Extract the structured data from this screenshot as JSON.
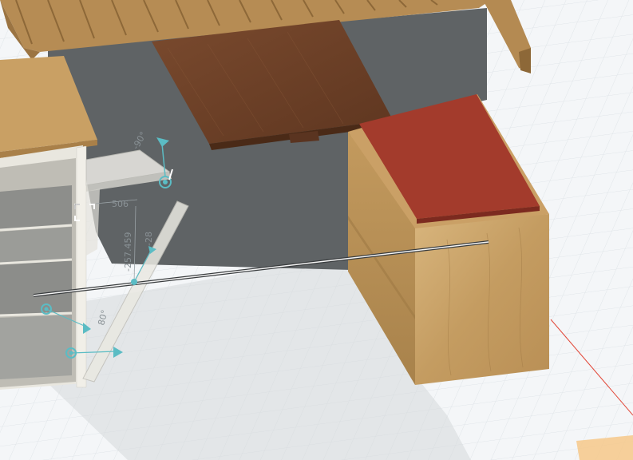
{
  "viewport": {
    "dimensions": {
      "a": "506",
      "b": "-257.459",
      "c": "-28",
      "d": "80°",
      "e": "-90°"
    }
  },
  "colors": {
    "grid_background": "#f4f6f8",
    "grid_line": "#dfe4e8",
    "wall": "#5f6365",
    "oak": "#c8a26a",
    "walnut": "#6b3e26",
    "cushion_red": "#a33b2c",
    "manipulator": "#5bbcc4",
    "axis_red": "#e24a3b"
  },
  "icons": {
    "rotate_handle": "rotate-handle-icon",
    "move_arrow": "move-arrow-icon",
    "select_bracket": "select-bracket-icon"
  }
}
